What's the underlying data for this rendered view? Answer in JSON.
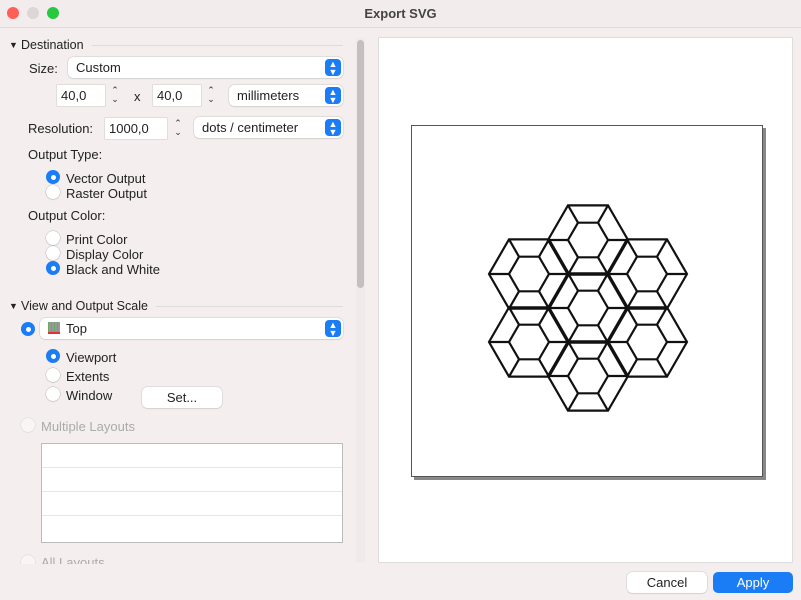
{
  "window": {
    "title": "Export SVG"
  },
  "destination": {
    "header": "Destination",
    "size_label": "Size:",
    "size_value": "Custom",
    "width": "40,0",
    "x": "x",
    "height": "40,0",
    "unit": "millimeters",
    "resolution_label": "Resolution:",
    "resolution": "1000,0",
    "resolution_unit": "dots / centimeter",
    "output_type_label": "Output Type:",
    "output_types": [
      {
        "label": "Vector Output",
        "selected": true
      },
      {
        "label": "Raster Output",
        "selected": false
      }
    ],
    "output_color_label": "Output Color:",
    "output_colors": [
      {
        "label": "Print Color",
        "selected": false
      },
      {
        "label": "Display Color",
        "selected": false
      },
      {
        "label": "Black and White",
        "selected": true
      }
    ]
  },
  "view": {
    "header": "View and Output Scale",
    "view_value": "Top",
    "options": [
      {
        "label": "Viewport",
        "selected": true
      },
      {
        "label": "Extents",
        "selected": false
      },
      {
        "label": "Window",
        "selected": false
      }
    ],
    "set_label": "Set...",
    "multiple_layouts": "Multiple Layouts",
    "all_layouts": "All Layouts"
  },
  "footer": {
    "cancel": "Cancel",
    "apply": "Apply"
  },
  "colors": {
    "accent": "#1a7df5"
  }
}
